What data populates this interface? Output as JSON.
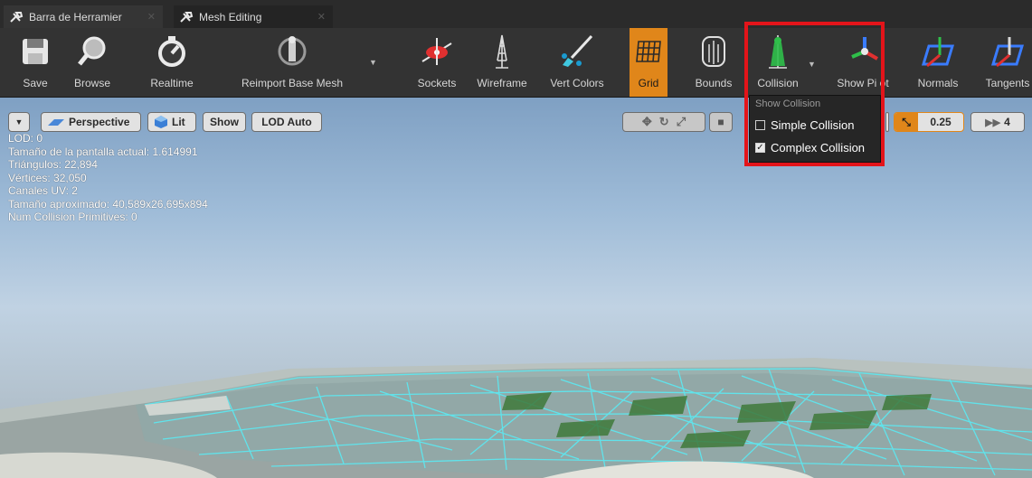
{
  "tabs": [
    {
      "label": "Barra de Herramier",
      "icon": "wrench-icon"
    },
    {
      "label": "Mesh Editing",
      "icon": "wrench-icon"
    }
  ],
  "toolbar": {
    "save": "Save",
    "browse": "Browse",
    "realtime": "Realtime",
    "reimport": "Reimport Base Mesh",
    "sockets": "Sockets",
    "wireframe": "Wireframe",
    "vertcolors": "Vert Colors",
    "grid": "Grid",
    "bounds": "Bounds",
    "collision": "Collision",
    "showpivot": "Show Pi  ot",
    "normals": "Normals",
    "tangents": "Tangents"
  },
  "viewport": {
    "perspective": "Perspective",
    "lit": "Lit",
    "show": "Show",
    "lod": "LOD Auto",
    "scale": "0.25",
    "camspeed": "4"
  },
  "stats": [
    "LOD:  0",
    "Tamaño de la pantalla actual: 1.614991",
    "Triángulos: 22,894",
    "Vértices: 32,050",
    "Canales UV: 2",
    "Tamaño aproximado: 40,589x26,695x894",
    "Num Collision Primitives:  0"
  ],
  "collision_menu": {
    "header": "Show Collision",
    "simple": "Simple Collision",
    "simple_checked": false,
    "complex": "Complex Collision",
    "complex_checked": true
  },
  "colors": {
    "accent": "#e0861a",
    "highlight": "#e3141a",
    "collision_mesh": "#5ee7ef"
  }
}
